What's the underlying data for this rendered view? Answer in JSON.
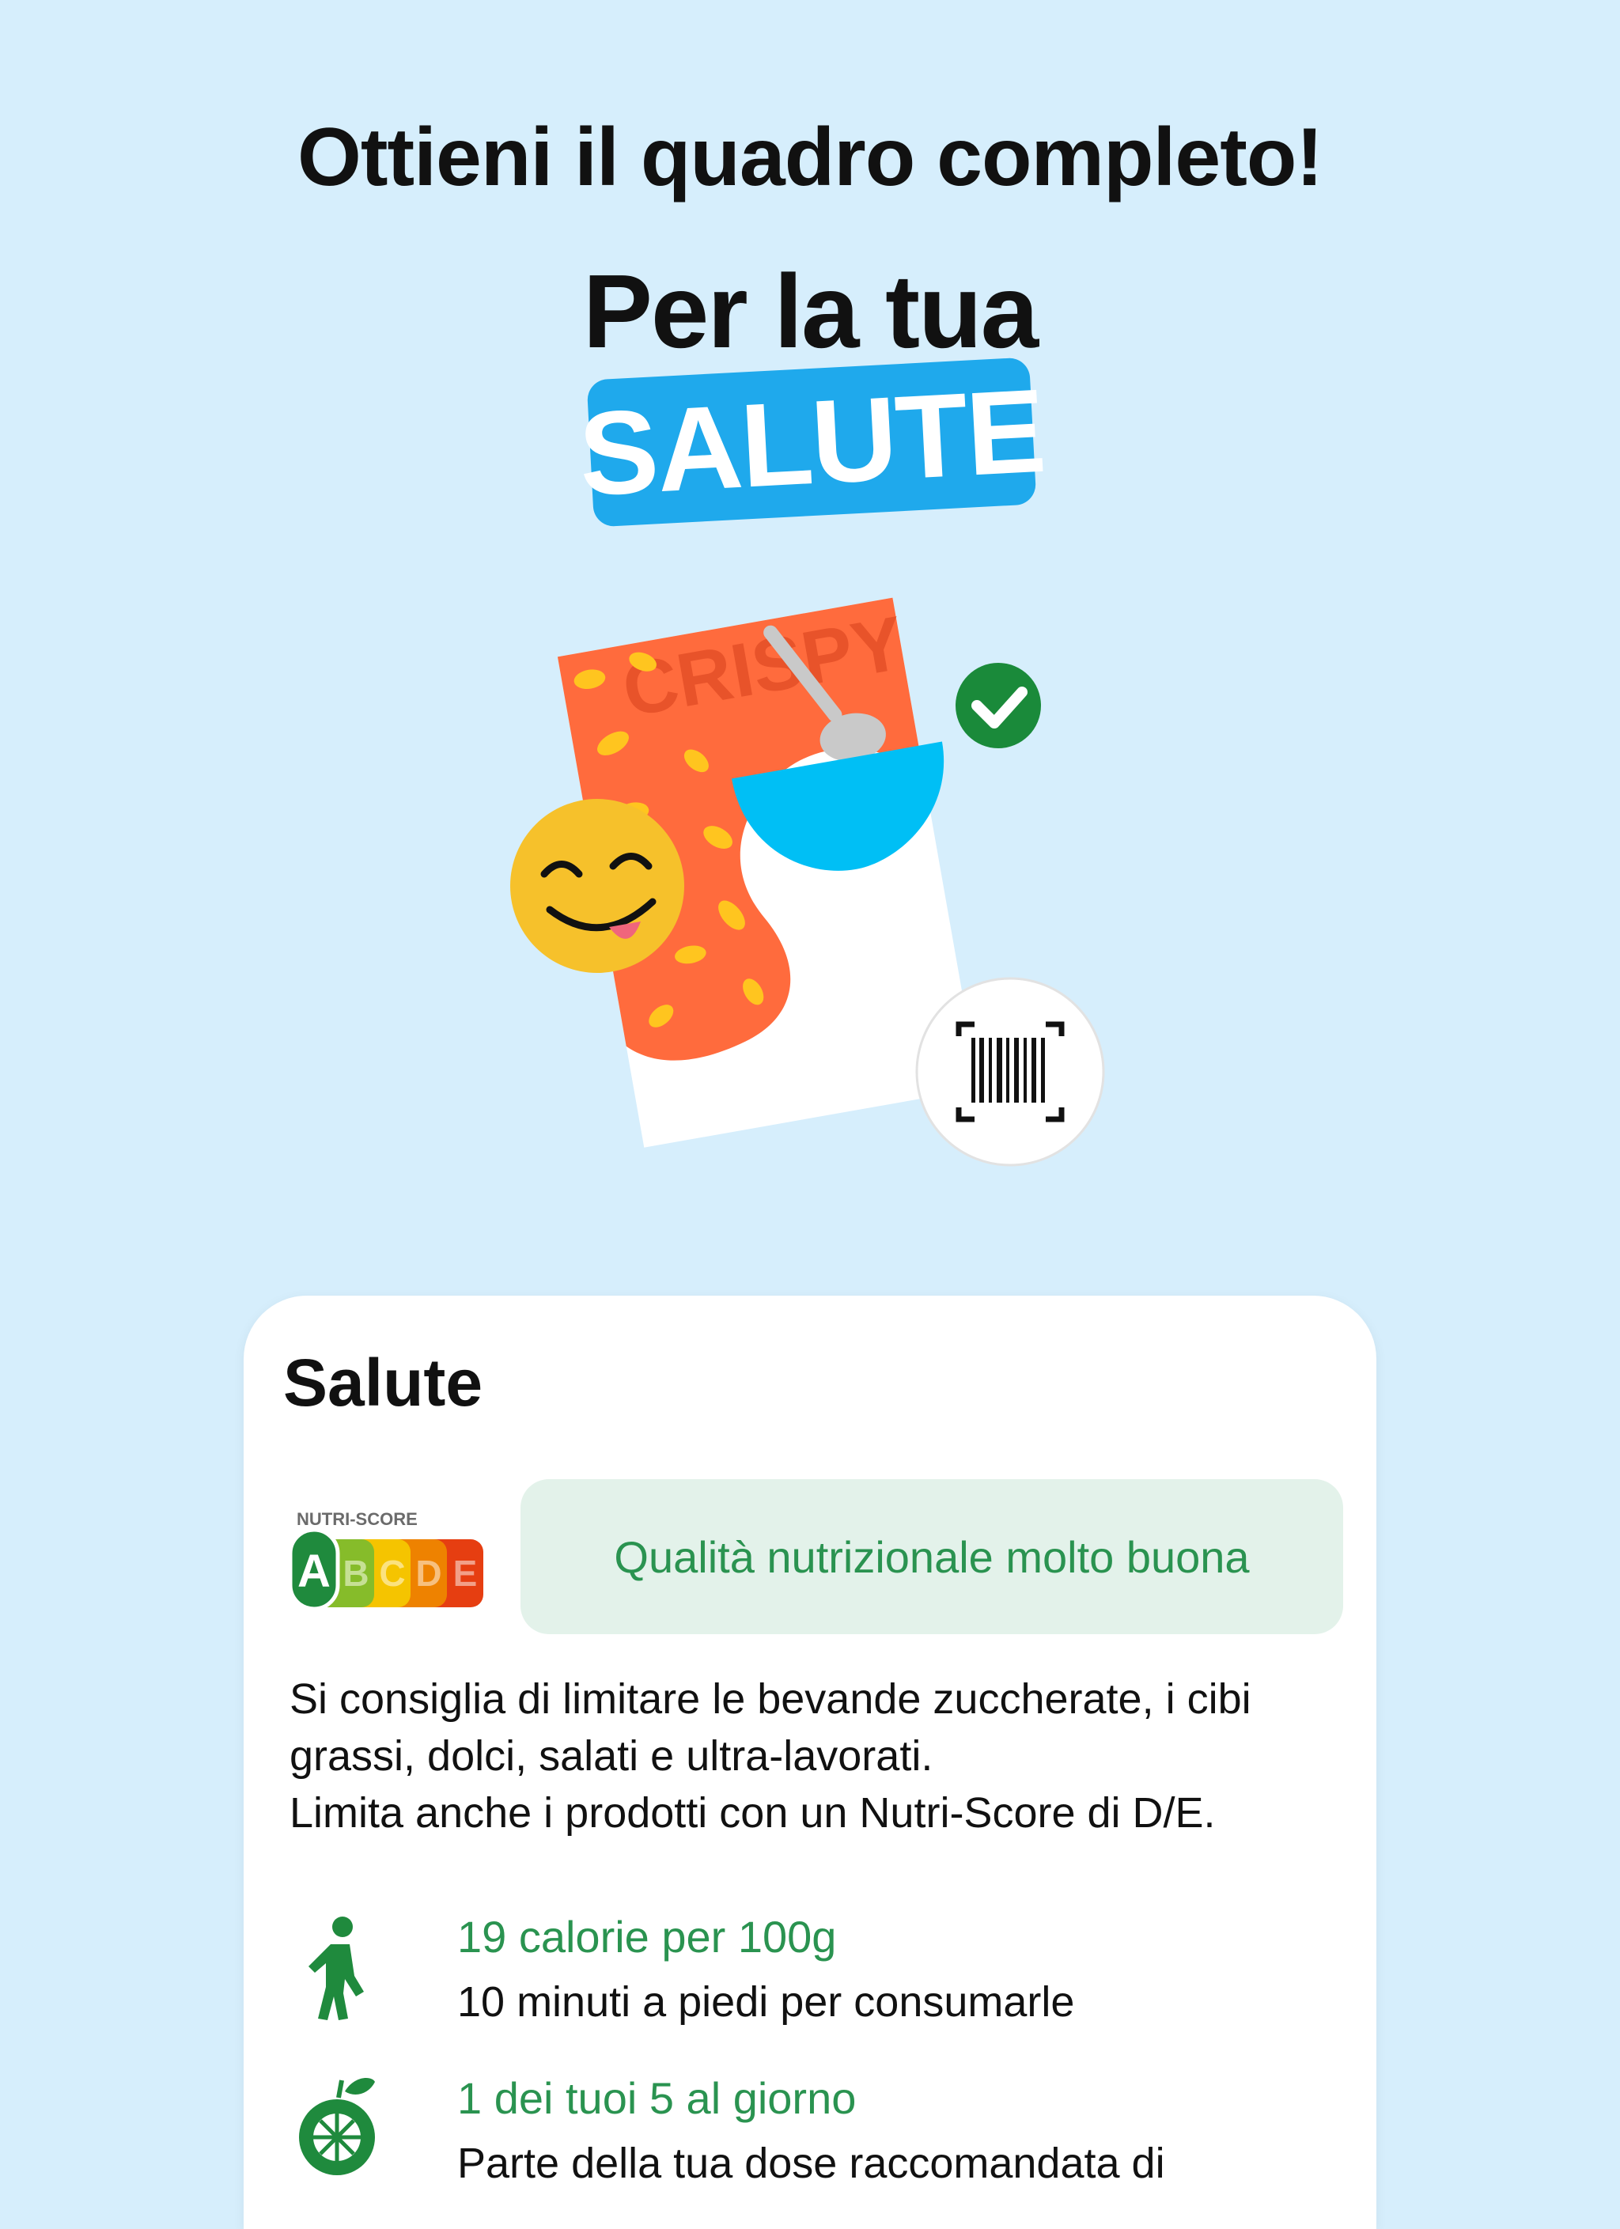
{
  "headline": "Ottieni il quadro completo!",
  "subheadline": "Per la tua",
  "badge": "SALUTE",
  "illustration": {
    "package_text": "CRISPY",
    "icons": [
      "check-icon",
      "smiley-icon",
      "barcode-scan-icon"
    ]
  },
  "card": {
    "title": "Salute",
    "nutriscore": {
      "label": "NUTRI-SCORE",
      "grades": [
        "A",
        "B",
        "C",
        "D",
        "E"
      ],
      "selected": "A",
      "colors": [
        "#1f8a3d",
        "#86bc2a",
        "#f5c400",
        "#ee8200",
        "#e63e11"
      ]
    },
    "quality": "Qualità nutrizionale molto buona",
    "advice": [
      "Si consiglia di limitare le bevande zuccherate, i cibi",
      "grassi, dolci, salati e ultra-lavorati.",
      "Limita anche i prodotti con un Nutri-Score di D/E."
    ],
    "rows": [
      {
        "icon": "walking-person-icon",
        "title": "19 calorie per 100g",
        "text": "10 minuti a piedi per consumarle"
      },
      {
        "icon": "citrus-fruit-icon",
        "title": "1 dei tuoi 5 al giorno",
        "text": "Parte della tua dose raccomandata di"
      }
    ]
  },
  "colors": {
    "background": "#d6eefc",
    "accent_blue": "#1fa9ec",
    "green_text": "#2a9350",
    "quality_bg": "#e3f2ea"
  }
}
